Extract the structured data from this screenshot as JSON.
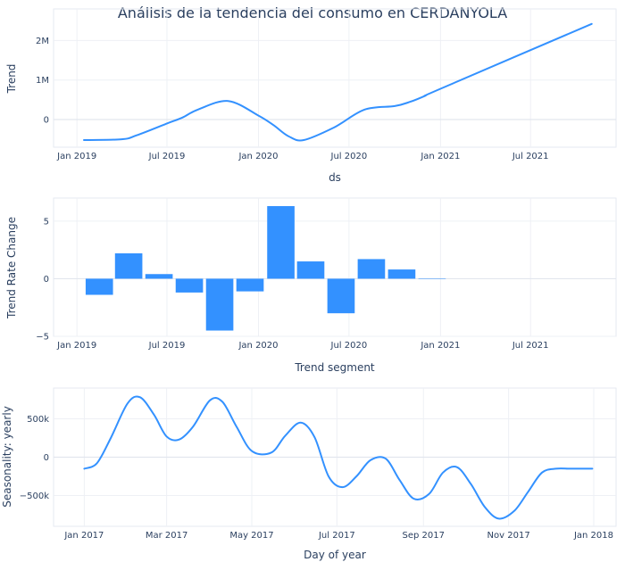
{
  "title": "Análisis de la tendencia del consumo en CERDANYOLA",
  "colors": {
    "series": "#3391ff",
    "text": "#2a3f5f"
  },
  "chart_data": [
    {
      "type": "line",
      "ylabel": "Trend",
      "xlabel": "ds",
      "x_ticks": [
        "Jan 2019",
        "Jul 2019",
        "Jan 2020",
        "Jul 2020",
        "Jan 2021",
        "Jul 2021"
      ],
      "y_ticks": [
        "0",
        "1M",
        "2M"
      ],
      "xlim": [
        "2018-11-15",
        "2021-12-20"
      ],
      "ylim": [
        -700000,
        2800000
      ],
      "grid": true,
      "series": [
        {
          "x": [
            "2019-01-15",
            "2019-04-01",
            "2019-05-01",
            "2019-07-01",
            "2019-08-01",
            "2019-09-01",
            "2019-11-01",
            "2020-01-01",
            "2020-02-01",
            "2020-03-01",
            "2020-04-01",
            "2020-06-01",
            "2020-08-01",
            "2020-10-01",
            "2020-11-01",
            "2020-12-01",
            "2021-01-01",
            "2021-11-01"
          ],
          "y": [
            -520000,
            -500000,
            -400000,
            -100000,
            50000,
            250000,
            470000,
            100000,
            -150000,
            -420000,
            -520000,
            -200000,
            250000,
            340000,
            450000,
            600000,
            780000,
            2420000
          ]
        }
      ]
    },
    {
      "type": "bar",
      "ylabel": "Trend Rate Change",
      "xlabel": "Trend segment",
      "x_ticks": [
        "Jan 2019",
        "Jul 2019",
        "Jan 2020",
        "Jul 2020",
        "Jan 2021",
        "Jul 2021"
      ],
      "y_ticks": [
        "−5",
        "0",
        "5"
      ],
      "xlim": [
        "2018-11-15",
        "2021-12-20"
      ],
      "ylim": [
        -5,
        7
      ],
      "grid": true,
      "bar_width_days": 55,
      "series": [
        {
          "x": [
            "2019-02-15",
            "2019-04-15",
            "2019-06-15",
            "2019-08-15",
            "2019-10-15",
            "2019-12-15",
            "2020-02-15",
            "2020-04-15",
            "2020-06-15",
            "2020-08-15",
            "2020-10-15",
            "2020-12-15"
          ],
          "y": [
            -1.4,
            2.2,
            0.4,
            -1.2,
            -4.5,
            -1.1,
            6.3,
            1.5,
            -3.0,
            1.7,
            0.8,
            0.0
          ]
        }
      ]
    },
    {
      "type": "line",
      "ylabel": "Seasonality: yearly",
      "xlabel": "Day of year",
      "x_ticks": [
        "Jan 2017",
        "Mar 2017",
        "May 2017",
        "Jul 2017",
        "Sep 2017",
        "Nov 2017",
        "Jan 2018"
      ],
      "y_ticks": [
        "−500k",
        "0",
        "500k"
      ],
      "xlim": [
        "2016-12-10",
        "2018-01-17"
      ],
      "ylim": [
        -900000,
        900000
      ],
      "grid": true,
      "series": [
        {
          "x": [
            "2017-01-01",
            "2017-01-10",
            "2017-01-20",
            "2017-02-01",
            "2017-02-10",
            "2017-02-20",
            "2017-03-01",
            "2017-03-10",
            "2017-03-20",
            "2017-04-01",
            "2017-04-10",
            "2017-04-20",
            "2017-05-01",
            "2017-05-15",
            "2017-05-25",
            "2017-06-05",
            "2017-06-15",
            "2017-06-25",
            "2017-07-05",
            "2017-07-15",
            "2017-07-25",
            "2017-08-05",
            "2017-08-15",
            "2017-08-25",
            "2017-09-05",
            "2017-09-15",
            "2017-09-25",
            "2017-10-05",
            "2017-10-15",
            "2017-10-25",
            "2017-11-05",
            "2017-11-15",
            "2017-11-25",
            "2017-12-05",
            "2017-12-15",
            "2017-12-25",
            "2017-12-31"
          ],
          "y": [
            -150000,
            -80000,
            250000,
            700000,
            780000,
            550000,
            270000,
            230000,
            400000,
            740000,
            720000,
            400000,
            80000,
            60000,
            280000,
            450000,
            260000,
            -250000,
            -390000,
            -250000,
            -40000,
            -20000,
            -300000,
            -540000,
            -480000,
            -200000,
            -130000,
            -350000,
            -650000,
            -800000,
            -700000,
            -450000,
            -200000,
            -150000,
            -150000,
            -150000,
            -150000
          ]
        }
      ]
    }
  ]
}
